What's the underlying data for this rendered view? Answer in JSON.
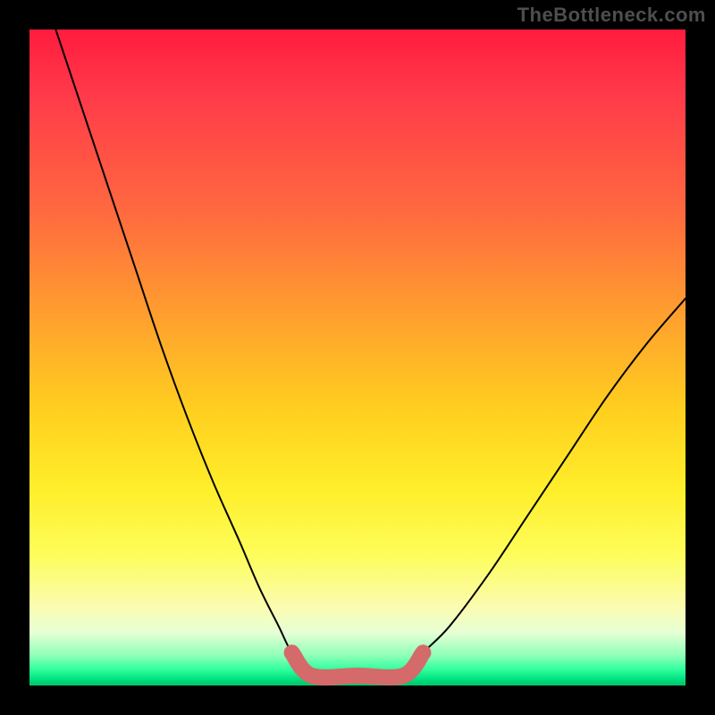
{
  "watermark": "TheBottleneck.com",
  "chart_data": {
    "type": "line",
    "title": "",
    "xlabel": "",
    "ylabel": "",
    "xlim": [
      0,
      1
    ],
    "ylim": [
      0,
      1
    ],
    "grid": false,
    "legend": false,
    "annotations": [],
    "series": [
      {
        "name": "v-curve",
        "color": "#000000",
        "x": [
          0.04,
          0.08,
          0.12,
          0.16,
          0.2,
          0.24,
          0.28,
          0.32,
          0.35,
          0.38,
          0.4,
          0.43,
          0.5,
          0.57,
          0.6,
          0.64,
          0.7,
          0.76,
          0.82,
          0.88,
          0.94,
          1.0
        ],
        "y": [
          1.0,
          0.88,
          0.76,
          0.64,
          0.52,
          0.41,
          0.31,
          0.22,
          0.15,
          0.09,
          0.05,
          0.015,
          0.015,
          0.015,
          0.05,
          0.09,
          0.17,
          0.26,
          0.35,
          0.44,
          0.52,
          0.59
        ]
      },
      {
        "name": "trough-marker",
        "color": "#d46a6a",
        "x": [
          0.4,
          0.43,
          0.5,
          0.57,
          0.6
        ],
        "y": [
          0.05,
          0.015,
          0.015,
          0.015,
          0.05
        ]
      }
    ],
    "colors": {
      "frame_border": "#000000",
      "gradient_top": "#ff1c3e",
      "gradient_yellow": "#ffee2a",
      "gradient_light": "#fbfcb0",
      "gradient_green": "#00e37f",
      "curve": "#000000",
      "marker": "#d46a6a"
    }
  }
}
